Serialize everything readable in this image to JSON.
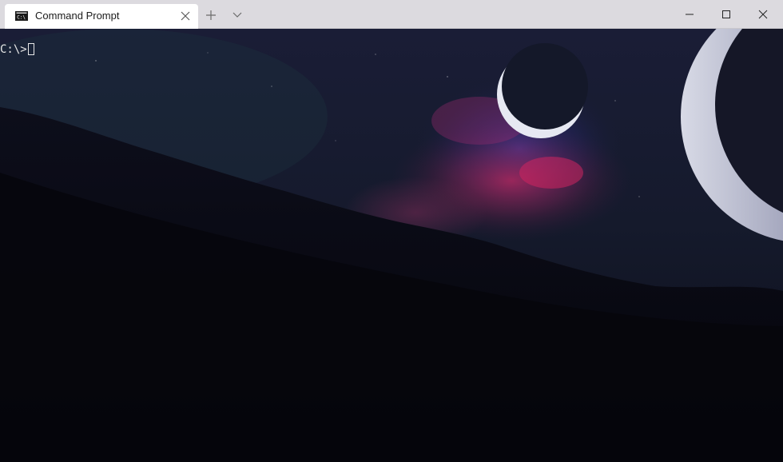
{
  "window": {
    "tab_title": "Command Prompt",
    "tab_icon": "cmd-icon",
    "new_tab_icon": "plus-icon",
    "dropdown_icon": "chevron-down-icon",
    "controls": [
      "minimize-icon",
      "maximize-icon",
      "close-icon"
    ]
  },
  "terminal": {
    "prompt": "C:\\>",
    "text_color": "#e8e8e8"
  },
  "theme": {
    "titlebar_bg": "#dcdadf",
    "tab_bg": "#ffffff",
    "terminal_bg": "#07070f"
  }
}
